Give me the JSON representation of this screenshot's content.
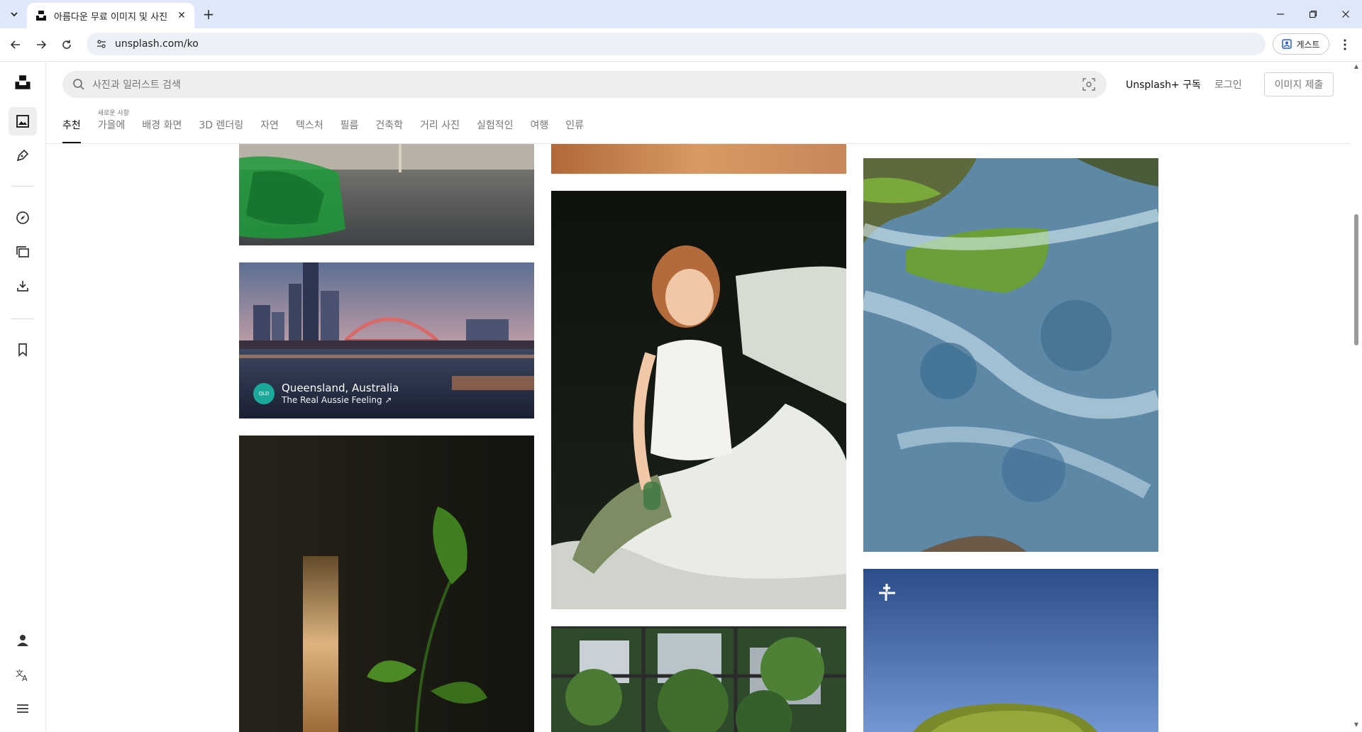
{
  "browser": {
    "tab_title": "아름다운 무료 이미지 및 사진",
    "url": "unsplash.com/ko",
    "guest_label": "게스트"
  },
  "header": {
    "search_placeholder": "사진과 일러스트 검색",
    "subscribe_label": "Unsplash+ 구독",
    "login_label": "로그인",
    "submit_label": "이미지 제출"
  },
  "topics": [
    {
      "label": "추천",
      "active": true
    },
    {
      "label": "가을에",
      "sup": "새로운 사항"
    },
    {
      "label": "배경 화면"
    },
    {
      "label": "3D 렌더링"
    },
    {
      "label": "자연"
    },
    {
      "label": "텍스처"
    },
    {
      "label": "필름"
    },
    {
      "label": "건축학"
    },
    {
      "label": "거리 사진"
    },
    {
      "label": "실험적인"
    },
    {
      "label": "여행"
    },
    {
      "label": "인류"
    }
  ],
  "sponsor": {
    "name": "Queensland, Australia",
    "tagline": "The Real Aussie Feeling ↗"
  },
  "icons": {
    "rail": [
      "unsplash-logo-icon",
      "photos-icon",
      "illustrations-icon",
      "explore-icon",
      "collections-icon",
      "download-icon",
      "bookmark-icon",
      "user-icon",
      "language-icon",
      "menu-icon"
    ]
  }
}
